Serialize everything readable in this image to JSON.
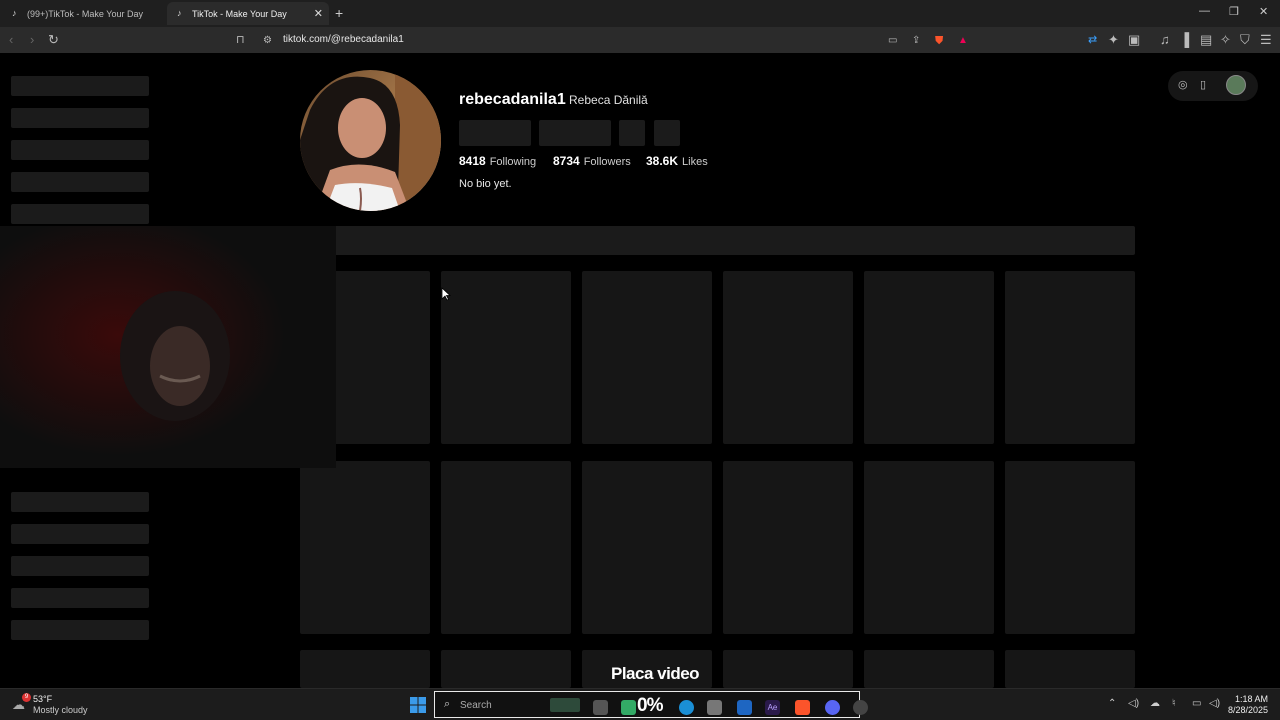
{
  "browser": {
    "tabs": [
      {
        "label": "(99+)TikTok - Make Your Day",
        "active": false
      },
      {
        "label": "TikTok - Make Your Day",
        "active": true
      }
    ],
    "url": "tiktok.com/@rebecadanila1"
  },
  "profile": {
    "username": "rebecadanila1",
    "display_name": "Rebeca Dănilă",
    "following_count": "8418",
    "following_label": "Following",
    "followers_count": "8734",
    "followers_label": "Followers",
    "likes_count": "38.6K",
    "likes_label": "Likes",
    "bio": "No bio yet."
  },
  "overlay": {
    "title": "Placa video"
  },
  "taskbar": {
    "weather_temp": "53°F",
    "weather_desc": "Mostly cloudy",
    "search_placeholder": "Search",
    "notification_count": "9",
    "percent": "0%",
    "time": "1:18 AM",
    "date": "8/28/2025"
  },
  "colors": {
    "page_bg": "#000000",
    "skeleton": "#1b1b1b",
    "chrome_bg": "#2b2b2b",
    "taskbar_bg": "#1c1c1c"
  }
}
